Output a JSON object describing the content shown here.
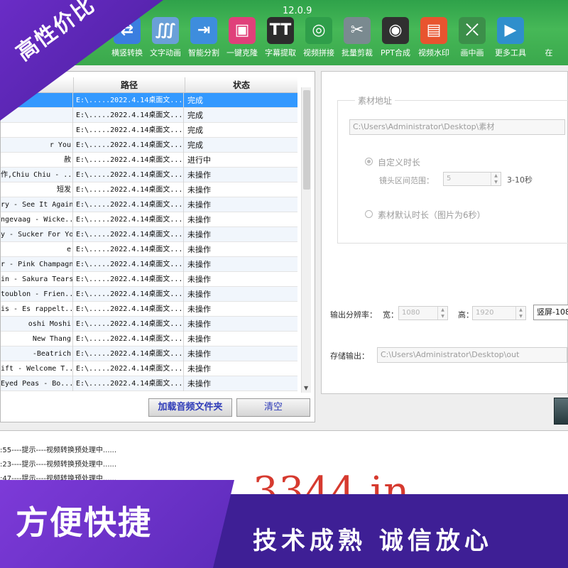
{
  "app": {
    "version": "12.0.9"
  },
  "toolbar": [
    {
      "label": "横竖转换",
      "icon": "rotate-icon",
      "glyph": "⇄",
      "color": "#3a7ee0"
    },
    {
      "label": "文字动画",
      "icon": "text-animation-icon",
      "glyph": "∭",
      "color": "#6aa0d8"
    },
    {
      "label": "智能分割",
      "icon": "split-icon",
      "glyph": "⇥",
      "color": "#3e8ddd"
    },
    {
      "label": "一键克隆",
      "icon": "clone-icon",
      "glyph": "▣",
      "color": "#e0407a"
    },
    {
      "label": "字幕提取",
      "icon": "subtitle-icon",
      "glyph": "TT",
      "color": "#2c2c2c"
    },
    {
      "label": "视频拼接",
      "icon": "video-join-icon",
      "glyph": "◎",
      "color": "#2f9e4a"
    },
    {
      "label": "批量剪裁",
      "icon": "crop-icon",
      "glyph": "✂",
      "color": "#7a8a90"
    },
    {
      "label": "PPT合成",
      "icon": "ppt-icon",
      "glyph": "◉",
      "color": "#303030"
    },
    {
      "label": "视频水印",
      "icon": "watermark-icon",
      "glyph": "▤",
      "color": "#e8542f"
    },
    {
      "label": "画中画",
      "icon": "pip-icon",
      "glyph": "⤫",
      "color": "#3c8f4a"
    },
    {
      "label": "更多工具",
      "icon": "more-tools-icon",
      "glyph": "▶",
      "color": "#2f8fcc"
    },
    {
      "label": "在",
      "icon": "",
      "glyph": "",
      "color": ""
    }
  ],
  "table": {
    "headers": {
      "path": "路径",
      "status": "状态"
    },
    "rows": [
      {
        "name": "",
        "path": "E:\\.....2022.4.14桌面文...",
        "status": "完成"
      },
      {
        "name": "",
        "path": "E:\\.....2022.4.14桌面文...",
        "status": "完成"
      },
      {
        "name": "",
        "path": "E:\\.....2022.4.14桌面文...",
        "status": "完成"
      },
      {
        "name": "r You",
        "path": "E:\\.....2022.4.14桌面文...",
        "status": "完成"
      },
      {
        "name": "赦",
        "path": "E:\\.....2022.4.14桌面文...",
        "status": "进行中"
      },
      {
        "name": "作,Chiu Chiu - ...",
        "path": "E:\\.....2022.4.14桌面文...",
        "status": "未操作"
      },
      {
        "name": "短发",
        "path": "E:\\.....2022.4.14桌面文...",
        "status": "未操作"
      },
      {
        "name": "ry - See It Again",
        "path": "E:\\.....2022.4.14桌面文...",
        "status": "未操作"
      },
      {
        "name": "ngevaag - Wicke...",
        "path": "E:\\.....2022.4.14桌面文...",
        "status": "未操作"
      },
      {
        "name": "y - Sucker For You",
        "path": "E:\\.....2022.4.14桌面文...",
        "status": "未操作"
      },
      {
        "name": "e",
        "path": "E:\\.....2022.4.14桌面文...",
        "status": "未操作"
      },
      {
        "name": "r - Pink Champagne",
        "path": "E:\\.....2022.4.14桌面文...",
        "status": "未操作"
      },
      {
        "name": "in - Sakura Tears",
        "path": "E:\\.....2022.4.14桌面文...",
        "status": "未操作"
      },
      {
        "name": "toublon - Frien...",
        "path": "E:\\.....2022.4.14桌面文...",
        "status": "未操作"
      },
      {
        "name": "is - Es rappelt...",
        "path": "E:\\.....2022.4.14桌面文...",
        "status": "未操作"
      },
      {
        "name": "oshi Moshi",
        "path": "E:\\.....2022.4.14桌面文...",
        "status": "未操作"
      },
      {
        "name": "New Thang",
        "path": "E:\\.....2022.4.14桌面文...",
        "status": "未操作"
      },
      {
        "name": "-Beatrich",
        "path": "E:\\.....2022.4.14桌面文...",
        "status": "未操作"
      },
      {
        "name": "ift - Welcome T...",
        "path": "E:\\.....2022.4.14桌面文...",
        "status": "未操作"
      },
      {
        "name": " Eyed Peas - Bo...",
        "path": "E:\\.....2022.4.14桌面文...",
        "status": "未操作"
      }
    ]
  },
  "buttons": {
    "load": "加载音频文件夹",
    "clear": "清空"
  },
  "settings": {
    "group_title": "素材地址",
    "material_path": "C:\\Users\\Administrator\\Desktop\\素材",
    "custom_duration": "自定义时长",
    "shot_range_label": "镜头区间范围：",
    "shot_range_value": "5",
    "shot_range_hint": "3-10秒",
    "default_duration": "素材默认时长（图片为6秒）",
    "resolution_label": "输出分辨率：",
    "width_label": "宽：",
    "width_value": "1080",
    "height_label": "高：",
    "height_value": "1920",
    "orientation": "竖屏-108",
    "output_label": "存储输出：",
    "output_path": "C:\\Users\\Administrator\\Desktop\\out"
  },
  "log": [
    ":55----提示----视频转换预处理中......",
    ":23----提示----视频转换预处理中......",
    ":47----提示----视频转换预处理中......"
  ],
  "watermark": "3344.in",
  "promo": {
    "top_left": "高性价比",
    "bottom_left": "方便快捷",
    "bottom_right": "技术成熟 诚信放心"
  }
}
